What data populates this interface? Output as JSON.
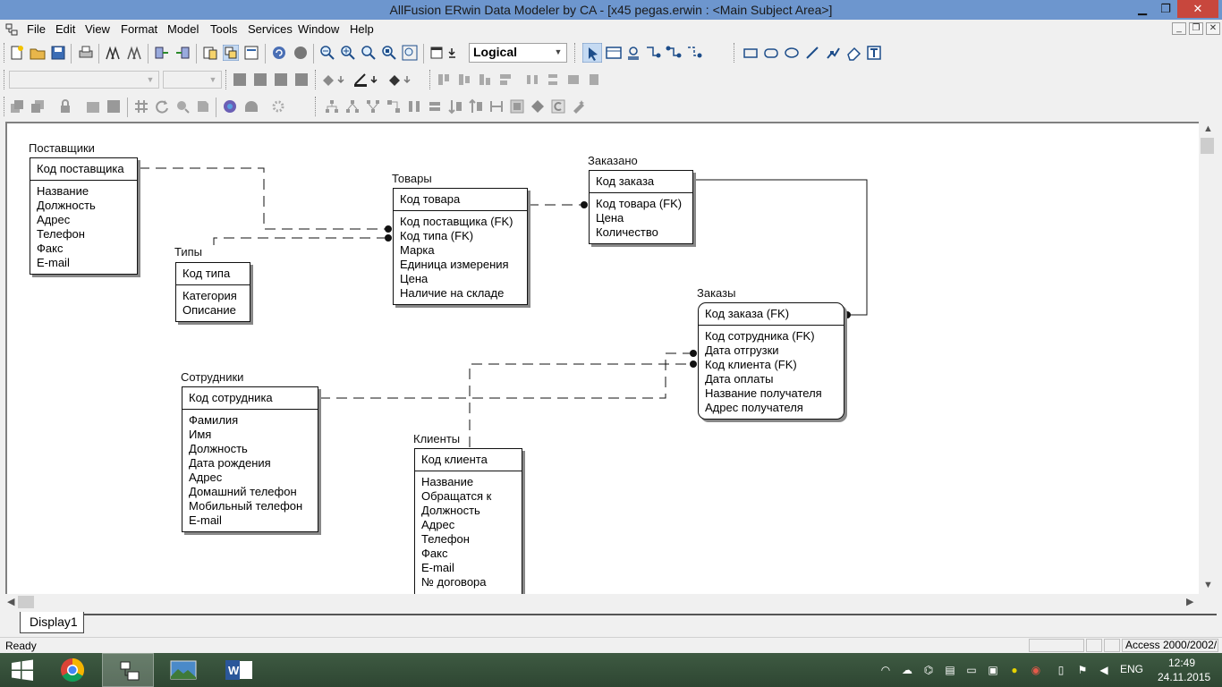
{
  "window": {
    "title": "AllFusion ERwin Data Modeler by CA - [x45 pegas.erwin : <Main Subject Area>]",
    "minimize_glyph": "▁",
    "maximize_glyph": "❐",
    "close_glyph": "✕"
  },
  "menu": {
    "items": [
      "File",
      "Edit",
      "View",
      "Format",
      "Model",
      "Tools",
      "Services",
      "Window",
      "Help"
    ],
    "mdi": {
      "minimize": "_",
      "restore": "❐",
      "close": "✕"
    }
  },
  "toolbar": {
    "view_level": "Logical",
    "font_name": "",
    "font_size": ""
  },
  "diagram": {
    "entities": [
      {
        "id": "suppliers",
        "name": "Поставщики",
        "key": "Код поставщика",
        "attrs": [
          "Название",
          "Должность",
          "Адрес",
          "Телефон",
          "Факс",
          "E-mail"
        ]
      },
      {
        "id": "types",
        "name": "Типы",
        "key": "Код типа",
        "attrs": [
          "Категория",
          "Описание"
        ]
      },
      {
        "id": "goods",
        "name": "Товары",
        "key": "Код товара",
        "attrs": [
          "Код поставщика (FK)",
          "Код типа (FK)",
          "Марка",
          "Единица измерения",
          "Цена",
          "Наличие на складе"
        ]
      },
      {
        "id": "ordered",
        "name": "Заказано",
        "key": "Код заказа",
        "attrs": [
          "Код товара (FK)",
          "Цена",
          "Количество"
        ]
      },
      {
        "id": "orders",
        "name": "Заказы",
        "key": "Код заказа (FK)",
        "attrs": [
          "Код сотрудника (FK)",
          "Дата отгрузки",
          "Код клиента (FK)",
          "Дата оплаты",
          "Название получателя",
          "Адрес получателя"
        ]
      },
      {
        "id": "employees",
        "name": "Сотрудники",
        "key": "Код сотрудника",
        "attrs": [
          "Фамилия",
          "Имя",
          "Должность",
          "Дата рождения",
          "Адрес",
          "Домашний телефон",
          "Мобильный телефон",
          "E-mail"
        ]
      },
      {
        "id": "clients",
        "name": "Клиенты",
        "key": "Код клиента",
        "attrs": [
          "Название",
          "Обращатся к",
          "Должность",
          "Адрес",
          "Телефон",
          "Факс",
          "E-mail",
          "№  договора"
        ]
      }
    ]
  },
  "tabs": {
    "active": "Display1"
  },
  "status": {
    "text": "Ready",
    "database": "Access 2000/2002/"
  },
  "taskbar": {
    "language": "ENG",
    "time": "12:49",
    "date": "24.11.2015"
  }
}
